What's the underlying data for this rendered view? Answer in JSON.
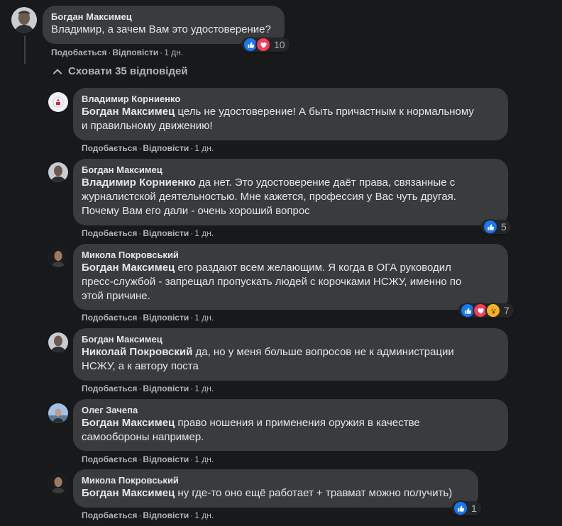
{
  "colors": {
    "background": "#18191a",
    "bubble": "#3a3b3c",
    "text": "#e4e6eb",
    "secondary_text": "#b0b3b8",
    "like": "#1877f2",
    "love": "#f33e58",
    "wow": "#f7b125"
  },
  "actions": {
    "like_label": "Подобається",
    "reply_label": "Відповісти",
    "separator": "·"
  },
  "toggle_replies": {
    "label": "Сховати 35 відповідей",
    "icon": "chevron-up-icon"
  },
  "comment": {
    "author": "Богдан Максимец",
    "text": "Владимир, а зачем Вам это удостоверение?",
    "time": "1 дн.",
    "reactions": [
      "like-icon",
      "love-icon"
    ],
    "reaction_count": "10"
  },
  "replies": [
    {
      "author": "Владимир Корниенко",
      "mention": "Богдан Максимец",
      "line1": " цель не удостоверение! А быть причастным к нормальному",
      "line2": "и правильному движению!",
      "time": "1 дн."
    },
    {
      "author": "Богдан Максимец",
      "mention": "Владимир Корниенко",
      "line1": " да нет. Это удостоверение даёт права, связанные с",
      "line2": "журналистской деятельностью. Мне кажется, профессия у Вас чуть другая.",
      "line3": "Почему Вам его дали - очень хороший вопрос",
      "time": "1 дн.",
      "reactions": [
        "like-icon"
      ],
      "reaction_count": "5"
    },
    {
      "author": "Микола Покровський",
      "mention": "Богдан Максимец",
      "line1": " его раздают всем желающим. Я когда в ОГА руководил",
      "line2": "пресс-службой - запрещал пропускать людей с корочками НСЖУ, именно по",
      "line3": "этой причине.",
      "time": "1 дн.",
      "reactions": [
        "like-icon",
        "love-icon",
        "wow-icon"
      ],
      "reaction_count": "7"
    },
    {
      "author": "Богдан Максимец",
      "mention": "Николай Покровский",
      "line1": " да, но у меня больше вопросов не к администрации",
      "line2": "НСЖУ, а к автору поста",
      "time": "1 дн."
    },
    {
      "author": "Олег Зачепа",
      "mention": "Богдан Максимец",
      "line1": " право ношения и применения оружия в качестве",
      "line2": "самообороны например.",
      "time": "1 дн."
    },
    {
      "author": "Микола Покровський",
      "mention": "Богдан Максимец",
      "line1": " ну где-то оно ещё работает + травмат можно получить)",
      "time": "1 дн.",
      "reactions": [
        "like-icon"
      ],
      "reaction_count": "1"
    }
  ]
}
